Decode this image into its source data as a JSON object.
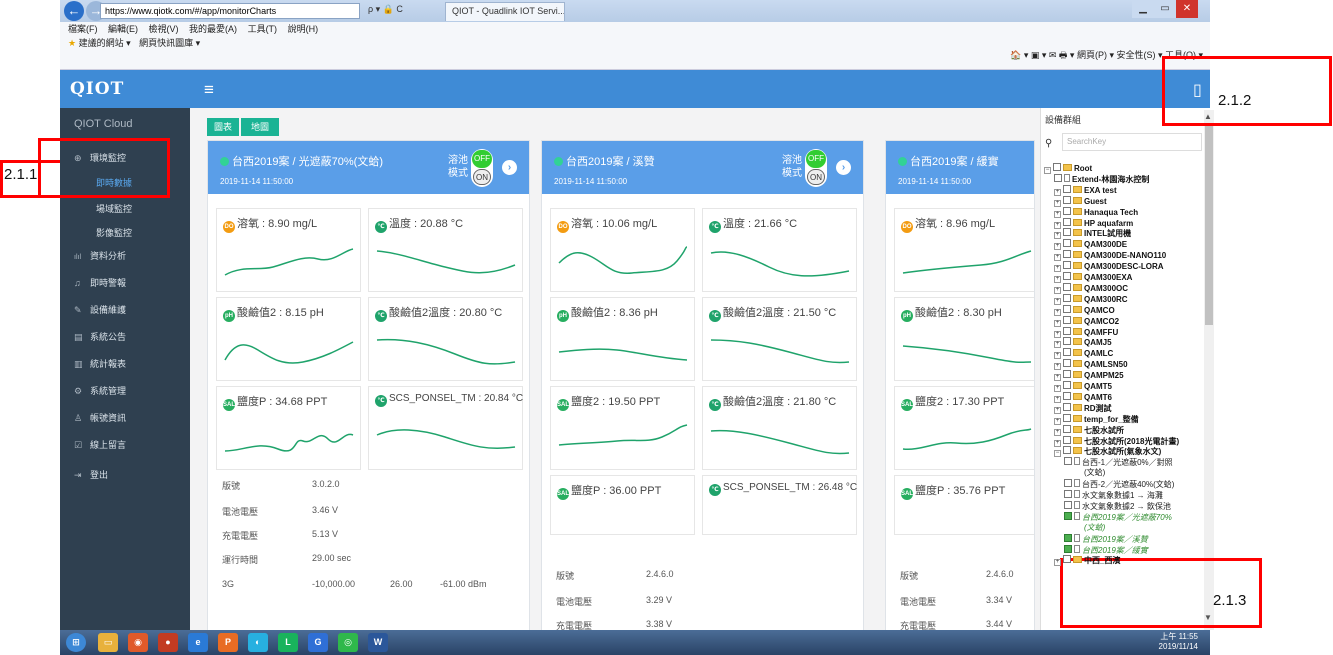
{
  "browser": {
    "url": "https://www.qiotk.com/#/app/monitorCharts",
    "tab_title": "QIOT - Quadlink IOT Servi...",
    "addr_icons": "ρ ▾ 🔒 C",
    "menu": [
      "檔案(F)",
      "編輯(E)",
      "檢視(V)",
      "我的最愛(A)",
      "工具(T)",
      "說明(H)"
    ],
    "favorites": [
      "建議的網站 ▾",
      "網頁快訊圖庫 ▾"
    ],
    "tools": "🏠 ▾ ▣ ▾ ✉ 🖶 ▾ 網頁(P) ▾ 安全性(S) ▾ 工具(O) ▾"
  },
  "app": {
    "logo": "QIOT",
    "hamburger": "≡",
    "panel_icon": "▯"
  },
  "sidebar": {
    "title": "QIOT Cloud",
    "items": [
      {
        "icon": "⊕",
        "label": "環境監控"
      },
      {
        "icon": "",
        "label": "即時數據"
      },
      {
        "icon": "",
        "label": "場域監控"
      },
      {
        "icon": "",
        "label": "影像監控"
      },
      {
        "icon": "ılıl",
        "label": "資料分析"
      },
      {
        "icon": "♫",
        "label": "即時警報"
      },
      {
        "icon": "✎",
        "label": "設備維護"
      },
      {
        "icon": "▤",
        "label": "系統公告"
      },
      {
        "icon": "▥",
        "label": "統計報表"
      },
      {
        "icon": "⚙",
        "label": "系統管理"
      },
      {
        "icon": "♙",
        "label": "帳號資訊"
      },
      {
        "icon": "☑",
        "label": "線上留言"
      },
      {
        "icon": "⇥",
        "label": "登出"
      }
    ]
  },
  "buttons": {
    "chart": "圖表",
    "map": "地圖"
  },
  "cards": [
    {
      "title": "台西2019案 / 光遮蔽70%(文蛤)",
      "time": "2019-11-14 11:50:00",
      "toggle_label": "溶池\n模式",
      "off": "OFF",
      "on": "ON",
      "cells": [
        {
          "icon": "DO",
          "label": "溶氧 : 8.90 mg/L"
        },
        {
          "icon": "🌡",
          "label": "溫度 : 20.88 °C"
        },
        {
          "icon": "pH",
          "label": "酸鹼值2 : 8.15 pH"
        },
        {
          "icon": "🌡",
          "label": "酸鹼值2溫度 : 20.80 °C"
        },
        {
          "icon": "SAL",
          "label": "鹽度P : 34.68 PPT"
        },
        {
          "icon": "🌡",
          "label": "SCS_PONSEL_TM : 20.84 °C"
        }
      ],
      "info": [
        [
          "版號",
          "3.0.2.0"
        ],
        [
          "電池電壓",
          "3.46 V"
        ],
        [
          "充電電壓",
          "5.13 V"
        ],
        [
          "運行時間",
          "29.00 sec"
        ]
      ],
      "signal": [
        "3G",
        "-10,000.00",
        "26.00",
        "-61.00 dBm"
      ]
    },
    {
      "title": "台西2019案 / 溪贊",
      "time": "2019-11-14 11:50:00",
      "toggle_label": "溶池\n模式",
      "off": "OFF",
      "on": "ON",
      "cells": [
        {
          "icon": "DO",
          "label": "溶氧 : 10.06 mg/L"
        },
        {
          "icon": "🌡",
          "label": "溫度 : 21.66 °C"
        },
        {
          "icon": "pH",
          "label": "酸鹼值2 : 8.36 pH"
        },
        {
          "icon": "🌡",
          "label": "酸鹼值2溫度 : 21.50 °C"
        },
        {
          "icon": "SAL",
          "label": "鹽度2 : 19.50 PPT"
        },
        {
          "icon": "🌡",
          "label": "酸鹼值2溫度 : 21.80 °C"
        },
        {
          "icon": "SAL",
          "label": "鹽度P : 36.00 PPT"
        },
        {
          "icon": "🌡",
          "label": "SCS_PONSEL_TM : 26.48 °C"
        }
      ],
      "info": [
        [
          "版號",
          "2.4.6.0"
        ],
        [
          "電池電壓",
          "3.29 V"
        ],
        [
          "充電電壓",
          "3.38 V"
        ]
      ]
    },
    {
      "title": "台西2019案 / 緩實",
      "time": "2019-11-14 11:50:00",
      "cells": [
        {
          "icon": "DO",
          "label": "溶氧 : 8.96 mg/L"
        },
        {
          "icon": "pH",
          "label": "酸鹼值2 : 8.30 pH"
        },
        {
          "icon": "SAL",
          "label": "鹽度2 : 17.30 PPT"
        },
        {
          "icon": "SAL",
          "label": "鹽度P : 35.76 PPT"
        }
      ],
      "info": [
        [
          "版號",
          "2.4.6.0"
        ],
        [
          "電池電壓",
          "3.34 V"
        ],
        [
          "充電電壓",
          "3.44 V"
        ]
      ]
    }
  ],
  "right_panel": {
    "title": "設備群組",
    "search_placeholder": "SearchKey",
    "tree": [
      "Root",
      "Extend-林園海水控制",
      "EXA test",
      "Guest",
      "Hanaqua Tech",
      "HP aquafarm",
      "INTEL試用機",
      "QAM300DE",
      "QAM300DE-NANO110",
      "QAM300DESC-LORA",
      "QAM300EXA",
      "QAM300OC",
      "QAM300RC",
      "QAMCO",
      "QAMCO2",
      "QAMFFU",
      "QAMJ5",
      "QAMLC",
      "QAMLSN50",
      "QAMPM25",
      "QAMT5",
      "QAMT6",
      "RD測試",
      "temp_for_整備",
      "七股水試所",
      "七股水試所(2018光電計畫)",
      "七股水試所(氣象水文)",
      "台西-1／光遮蔽0%／對照",
      "(文蛤)",
      "台西-2／光遮蔽40%(文蛤)",
      "水文氣象數據1 → 海灘",
      "水文氣象數據2 → 飲保池",
      "台西2019案／光遮蔽70%",
      "(文蛤)",
      "台西2019案／溪贊",
      "台西2019案／緩實",
      "中西_西濱"
    ]
  },
  "annotations": [
    "2.1.1",
    "2.1.2",
    "2.1.3"
  ],
  "taskbar": {
    "clock_time": "上午 11:55",
    "clock_date": "2019/11/14"
  },
  "colors": {
    "topbar": "#3f8bd6",
    "sidebar": "#2f4050",
    "card_head": "#5a9ee8",
    "accent": "#1ab394",
    "annotation": "#ff0000"
  }
}
